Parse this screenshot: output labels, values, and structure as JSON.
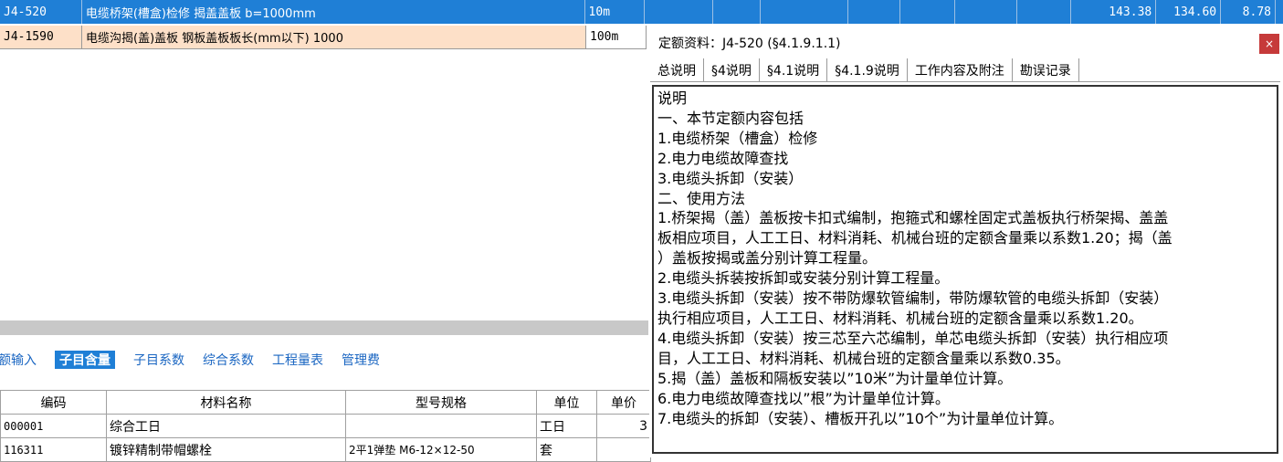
{
  "rows": [
    {
      "code": "J4-520",
      "name": "电缆桥架(槽盒)检修 揭盖盖板 b=1000mm",
      "unit": "10m",
      "v1": "143.38",
      "v2": "134.60",
      "v3": "8.78"
    },
    {
      "code": "J4-1590",
      "name": "电缆沟揭(盖)盖板 钢板盖板板长(mm以下) 1000",
      "unit": "100m"
    }
  ],
  "subtabs": [
    "额输入",
    "子目含量",
    "子目系数",
    "综合系数",
    "工程量表",
    "管理费"
  ],
  "materials": {
    "headers": [
      "编码",
      "材料名称",
      "型号规格",
      "单位",
      "单价"
    ],
    "rows": [
      {
        "code": "000001",
        "name": "综合工日",
        "spec": "",
        "unit": "工日",
        "price": "3"
      },
      {
        "code": "116311",
        "name": "镀锌精制带帽螺栓",
        "spec": "2平1弹垫 M6-12×12-50",
        "unit": "套",
        "price": ""
      }
    ]
  },
  "panel": {
    "title": "定额资料：J4-520 (§4.1.9.1.1)",
    "close": "×",
    "tabs": [
      "总说明",
      "§4说明",
      "§4.1说明",
      "§4.1.9说明",
      "工作内容及附注",
      "勘误记录"
    ],
    "lines": [
      "说明",
      "一、本节定额内容包括",
      "1.电缆桥架（槽盒）检修",
      "2.电力电缆故障查找",
      "3.电缆头拆卸（安装）",
      "二、使用方法",
      "1.桥架揭（盖）盖板按卡扣式编制，抱箍式和螺栓固定式盖板执行桥架揭、盖盖",
      "板相应项目，人工工日、材料消耗、机械台班的定额含量乘以系数1.20；揭（盖",
      "）盖板按揭或盖分别计算工程量。",
      "2.电缆头拆装按拆卸或安装分别计算工程量。",
      "3.电缆头拆卸（安装）按不带防爆软管编制，带防爆软管的电缆头拆卸（安装）",
      "执行相应项目，人工工日、材料消耗、机械台班的定额含量乘以系数1.20。",
      "4.电缆头拆卸（安装）按三芯至六芯编制，单芯电缆头拆卸（安装）执行相应项",
      "目，人工工日、材料消耗、机械台班的定额含量乘以系数0.35。",
      "5.揭（盖）盖板和隔板安装以”10米”为计量单位计算。",
      "6.电力电缆故障查找以”根”为计量单位计算。",
      "7.电缆头的拆卸（安装）、槽板开孔以”10个”为计量单位计算。"
    ]
  }
}
